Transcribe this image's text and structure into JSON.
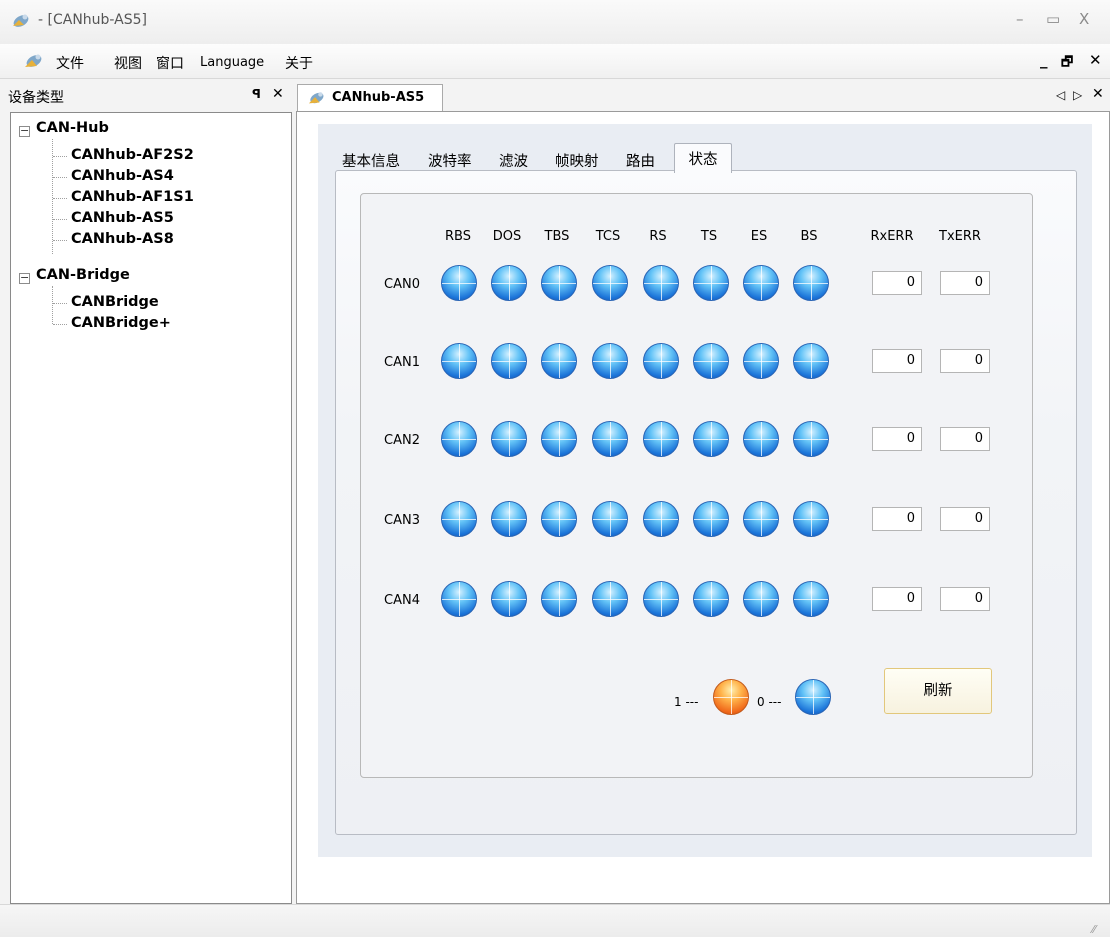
{
  "window": {
    "title": "- [CANhub-AS5]",
    "minimize": "–",
    "maximize": "▭",
    "close": "X"
  },
  "menu": {
    "items": [
      "文件",
      "视图",
      "窗口",
      "Language",
      "关于"
    ],
    "mdi_min": "_",
    "mdi_restore": "🗗",
    "mdi_close": "✕"
  },
  "left_panel": {
    "title": "设备类型",
    "pin": "ꟼ",
    "close": "✕",
    "tree": [
      {
        "label": "CAN-Hub",
        "expander": "−",
        "children": [
          "CANhub-AF2S2",
          "CANhub-AS4",
          "CANhub-AF1S1",
          "CANhub-AS5",
          "CANhub-AS8"
        ]
      },
      {
        "label": "CAN-Bridge",
        "expander": "−",
        "children": [
          "CANBridge",
          "CANBridge+"
        ]
      }
    ]
  },
  "document": {
    "tab_label": "CANhub-AS5",
    "nav_prev": "◁",
    "nav_next": "▷",
    "nav_close": "✕"
  },
  "tabs": [
    "基本信息",
    "波特率",
    "滤波",
    "帧映射",
    "路由",
    "状态"
  ],
  "status": {
    "columns": [
      "RBS",
      "DOS",
      "TBS",
      "TCS",
      "RS",
      "TS",
      "ES",
      "BS"
    ],
    "err_columns": [
      "RxERR",
      "TxERR"
    ],
    "rows": [
      {
        "label": "CAN0",
        "bits": [
          0,
          0,
          0,
          0,
          0,
          0,
          0,
          0
        ],
        "rx": "0",
        "tx": "0"
      },
      {
        "label": "CAN1",
        "bits": [
          0,
          0,
          0,
          0,
          0,
          0,
          0,
          0
        ],
        "rx": "0",
        "tx": "0"
      },
      {
        "label": "CAN2",
        "bits": [
          0,
          0,
          0,
          0,
          0,
          0,
          0,
          0
        ],
        "rx": "0",
        "tx": "0"
      },
      {
        "label": "CAN3",
        "bits": [
          0,
          0,
          0,
          0,
          0,
          0,
          0,
          0
        ],
        "rx": "0",
        "tx": "0"
      },
      {
        "label": "CAN4",
        "bits": [
          0,
          0,
          0,
          0,
          0,
          0,
          0,
          0
        ],
        "rx": "0",
        "tx": "0"
      }
    ],
    "legend_one": "1 ---",
    "legend_zero": "0 ---",
    "led_one_color": "#f0681a",
    "led_zero_color": "#1b73d8",
    "refresh_label": "刷新"
  },
  "statusbar": {
    "grip": "⁄⁄"
  }
}
